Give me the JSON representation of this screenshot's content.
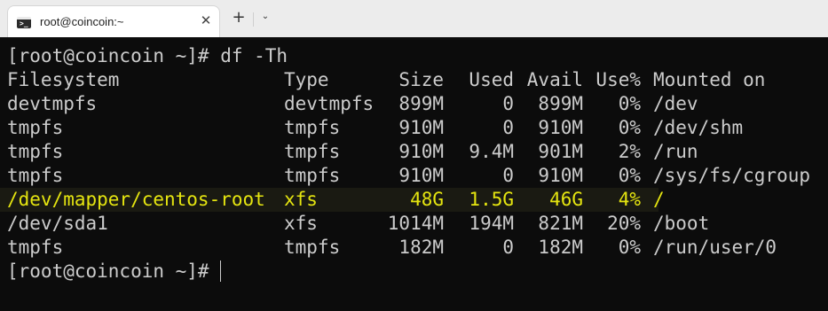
{
  "window": {
    "tab_title": "root@coincoin:~",
    "tab_icon": "terminal-icon",
    "close_glyph": "✕",
    "new_tab_glyph": "+",
    "dropdown_glyph": "⌄"
  },
  "terminal": {
    "command_line": "[root@coincoin ~]# df -Th",
    "headers": [
      "Filesystem",
      "Type",
      "Size",
      "Used",
      "Avail",
      "Use%",
      "Mounted on"
    ],
    "rows": [
      [
        "devtmpfs",
        "devtmpfs",
        "899M",
        "0",
        "899M",
        "0%",
        "/dev"
      ],
      [
        "tmpfs",
        "tmpfs",
        "910M",
        "0",
        "910M",
        "0%",
        "/dev/shm"
      ],
      [
        "tmpfs",
        "tmpfs",
        "910M",
        "9.4M",
        "901M",
        "2%",
        "/run"
      ],
      [
        "tmpfs",
        "tmpfs",
        "910M",
        "0",
        "910M",
        "0%",
        "/sys/fs/cgroup"
      ],
      [
        "/dev/mapper/centos-root",
        "xfs",
        "48G",
        "1.5G",
        "46G",
        "4%",
        "/"
      ],
      [
        "/dev/sda1",
        "xfs",
        "1014M",
        "194M",
        "821M",
        "20%",
        "/boot"
      ],
      [
        "tmpfs",
        "tmpfs",
        "182M",
        "0",
        "182M",
        "0%",
        "/run/user/0"
      ]
    ],
    "highlighted_row_index": 4,
    "prompt": "[root@coincoin ~]#",
    "colors": {
      "background": "#0c0c0c",
      "text": "#cccccc",
      "highlight": "#e5e510"
    }
  }
}
